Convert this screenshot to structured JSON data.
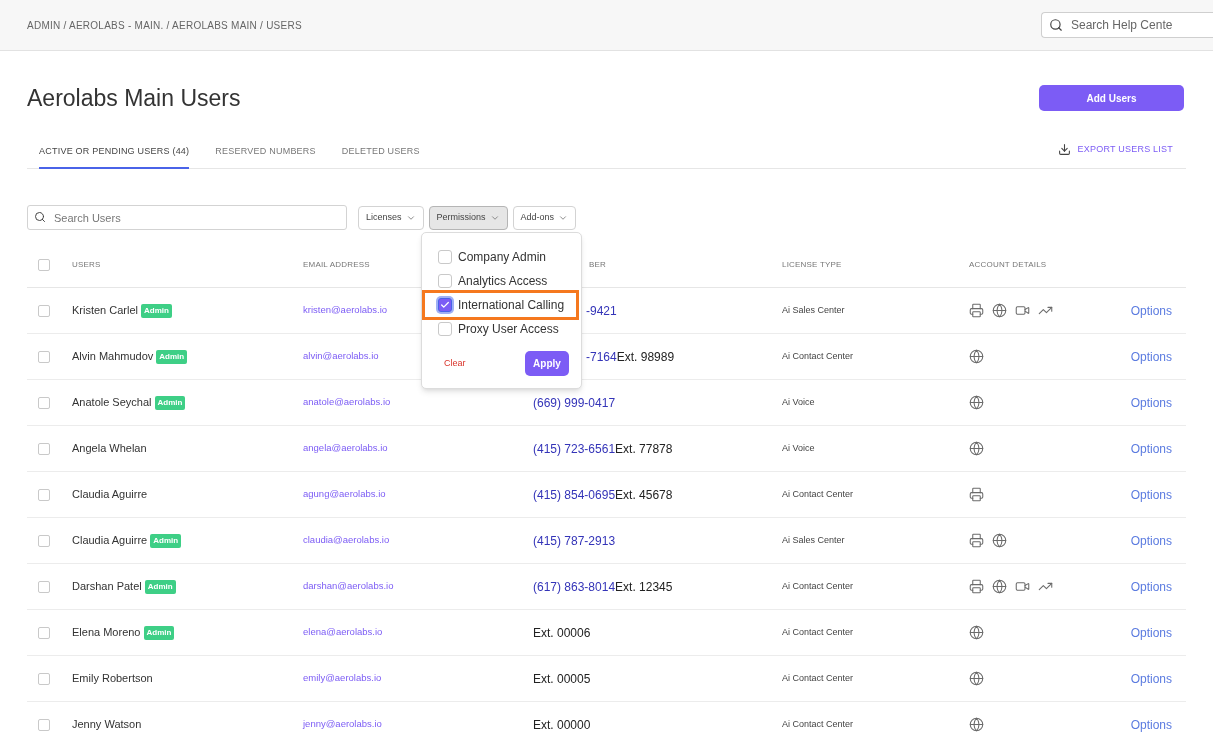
{
  "breadcrumb": "ADMIN / AEROLABS - MAIN. / AEROLABS MAIN / USERS",
  "help_search": {
    "placeholder": "Search Help Cente"
  },
  "title": "Aerolabs Main Users",
  "add_button": "Add Users",
  "tabs": [
    {
      "label": "ACTIVE OR PENDING USERS (44)",
      "selected": true
    },
    {
      "label": "RESERVED NUMBERS",
      "selected": false
    },
    {
      "label": "DELETED USERS",
      "selected": false
    }
  ],
  "export_link": "EXPORT USERS LIST",
  "user_search": {
    "placeholder": "Search Users"
  },
  "filters": [
    {
      "label": "Licenses",
      "open": false
    },
    {
      "label": "Permissions",
      "open": true
    },
    {
      "label": "Add-ons",
      "open": false
    }
  ],
  "permissions_menu": {
    "options": [
      {
        "label": "Company Admin",
        "checked": false,
        "highlighted": false
      },
      {
        "label": "Analytics Access",
        "checked": false,
        "highlighted": false
      },
      {
        "label": "International Calling",
        "checked": true,
        "highlighted": true
      },
      {
        "label": "Proxy User Access",
        "checked": false,
        "highlighted": false
      }
    ],
    "clear": "Clear",
    "apply": "Apply"
  },
  "table": {
    "select_all": {
      "checked": false
    },
    "columns": [
      "USERS",
      "EMAIL ADDRESS",
      "BER",
      "LICENSE TYPE",
      "ACCOUNT DETAILS"
    ],
    "rows": [
      {
        "checked": false,
        "name": "Kristen Carlel",
        "badge": "Admin",
        "email": "kristen@aerolabs.io",
        "phone": {
          "number": "-9421",
          "covered": true
        },
        "license": "Ai Sales Center",
        "icons": [
          {
            "kind": "printer"
          },
          {
            "kind": "globe"
          },
          {
            "kind": "video"
          },
          {
            "kind": "trend"
          }
        ],
        "action": "Options"
      },
      {
        "checked": false,
        "name": "Alvin Mahmudov",
        "badge": "Admin",
        "email": "alvin@aerolabs.io",
        "phone": {
          "number": "-7164",
          "ext": "Ext. 98989",
          "covered": true
        },
        "license": "Ai Contact Center",
        "icons": [
          {
            "kind": "globe"
          }
        ],
        "action": "Options"
      },
      {
        "checked": false,
        "name": "Anatole Seychal",
        "badge": "Admin",
        "email": "anatole@aerolabs.io",
        "phone": {
          "number": "(669) 999-0417",
          "covered": false
        },
        "license": "Ai Voice",
        "icons": [
          {
            "kind": "globe"
          }
        ],
        "action": "Options"
      },
      {
        "checked": false,
        "name": "Angela Whelan",
        "email": "angela@aerolabs.io",
        "phone": {
          "number": "(415) 723-6561",
          "ext": "Ext. 77878",
          "covered": false
        },
        "license": "Ai Voice",
        "icons": [
          {
            "kind": "globe"
          }
        ],
        "action": "Options"
      },
      {
        "checked": false,
        "name": "Claudia Aguirre",
        "email": "agung@aerolabs.io",
        "phone": {
          "number": "(415) 854-0695",
          "ext": "Ext. 45678",
          "covered": false
        },
        "license": "Ai Contact Center",
        "icons": [
          {
            "kind": "printer"
          }
        ],
        "action": "Options"
      },
      {
        "checked": false,
        "name": "Claudia Aguirre",
        "badge": "Admin",
        "email": "claudia@aerolabs.io",
        "phone": {
          "number": "(415) 787-2913",
          "covered": false
        },
        "license": "Ai Sales Center",
        "icons": [
          {
            "kind": "printer"
          },
          {
            "kind": "globe"
          }
        ],
        "action": "Options"
      },
      {
        "checked": false,
        "name": "Darshan Patel",
        "badge": "Admin",
        "email": "darshan@aerolabs.io",
        "phone": {
          "number": "(617) 863-8014",
          "ext": "Ext. 12345",
          "covered": false
        },
        "license": "Ai Contact Center",
        "icons": [
          {
            "kind": "printer"
          },
          {
            "kind": "globe"
          },
          {
            "kind": "video"
          },
          {
            "kind": "trend"
          }
        ],
        "action": "Options"
      },
      {
        "checked": false,
        "name": "Elena Moreno",
        "badge": "Admin",
        "email": "elena@aerolabs.io",
        "phone": {
          "ext": "Ext. 00006",
          "covered": false
        },
        "license": "Ai Contact Center",
        "icons": [
          {
            "kind": "globe"
          }
        ],
        "action": "Options"
      },
      {
        "checked": false,
        "name": "Emily Robertson",
        "email": "emily@aerolabs.io",
        "phone": {
          "ext": "Ext. 00005",
          "covered": false
        },
        "license": "Ai Contact Center",
        "icons": [
          {
            "kind": "globe"
          }
        ],
        "action": "Options"
      },
      {
        "checked": false,
        "name": "Jenny Watson",
        "email": "jenny@aerolabs.io",
        "phone": {
          "ext": "Ext. 00000",
          "covered": false
        },
        "license": "Ai Contact Center",
        "icons": [
          {
            "kind": "globe"
          }
        ],
        "action": "Options"
      }
    ]
  }
}
